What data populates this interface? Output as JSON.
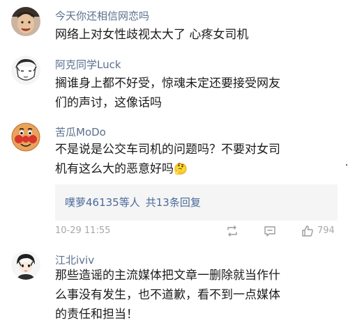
{
  "comments": [
    {
      "username": "今天你还相信网恋吗",
      "text_lines": [
        "网络上对女性歧视太大了 心疼女司机"
      ],
      "avatar_icon": "photo-avatar"
    },
    {
      "username": "阿克同学Luck",
      "text_lines": [
        "搁谁身上都不好受，惊魂未定还要接受网友",
        "们的声讨，这像话吗"
      ],
      "avatar_icon": "sketch-avatar"
    },
    {
      "username": "苦瓜MoDo",
      "text_lines": [
        "不是说是公交车司机的问题吗？不要对女司",
        "机有这么大的恶意好吗"
      ],
      "emoji": "🤔",
      "avatar_icon": "cartoon-bread-avatar",
      "replies": {
        "first_replier": "噗萝46135",
        "suffix": "等人",
        "total": "共13条回复"
      },
      "time": "10-29 11:55",
      "like_count": "794",
      "icons": [
        "repost-icon",
        "comment-icon",
        "like-icon"
      ]
    },
    {
      "username": "江北iviv",
      "text_lines": [
        "那些造谣的主流媒体把文章一删除就当作什",
        "么事没有发生，也不道歉，看不到一点媒体",
        "的责任和担当！"
      ],
      "avatar_icon": "anime-avatar"
    }
  ],
  "colors": {
    "username": "#5a6f8c",
    "text": "#1a1a1a",
    "link": "#4a6a9c",
    "meta": "#a8a8a8",
    "reply_bg": "#f5f5f5"
  }
}
